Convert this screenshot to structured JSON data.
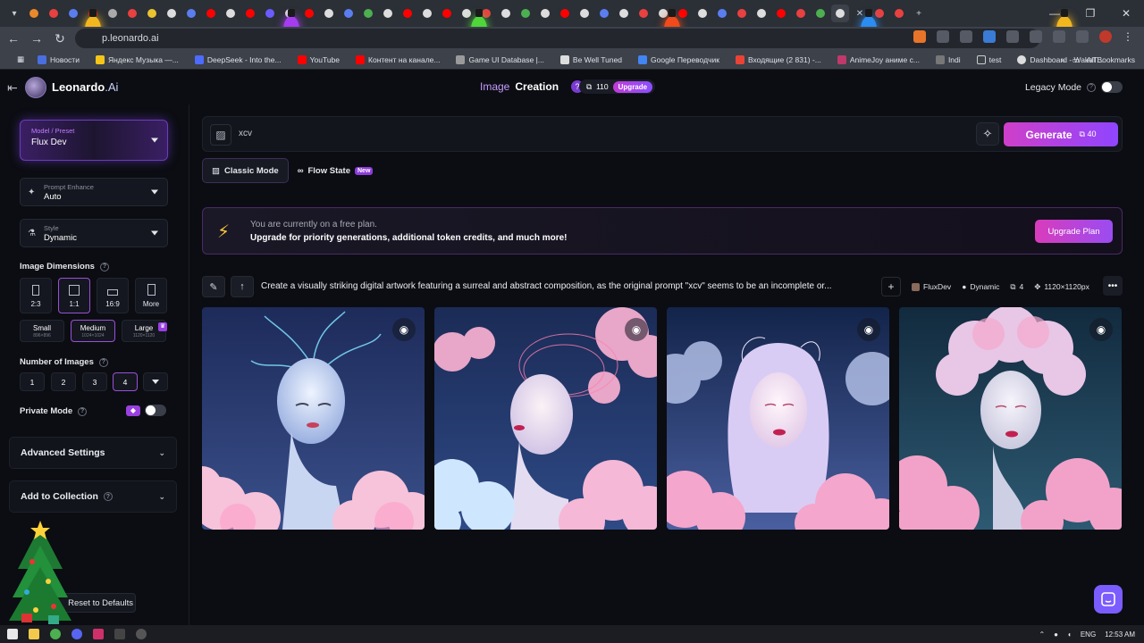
{
  "browser": {
    "url": "p.leonardo.ai",
    "bookmarks": [
      {
        "label": "Новости",
        "color": "#4a6ee0"
      },
      {
        "label": "Яндекс Музыка —...",
        "color": "#f5c518"
      },
      {
        "label": "DeepSeek - Into the...",
        "color": "#4d6bfe"
      },
      {
        "label": "YouTube",
        "color": "#ff0000"
      },
      {
        "label": "Контент на канале...",
        "color": "#ff0000"
      },
      {
        "label": "Game UI Database |...",
        "color": "#9a9a9a"
      },
      {
        "label": "Be Well Tuned",
        "color": "#dddddd"
      },
      {
        "label": "Google Переводчик",
        "color": "#4285f4"
      },
      {
        "label": "Входящие (2 831) -...",
        "color": "#ea4335"
      },
      {
        "label": "AnimeJoy аниме с...",
        "color": "#c0396b"
      },
      {
        "label": "Indi",
        "color": "#777777"
      },
      {
        "label": "test",
        "color": "#777777"
      },
      {
        "label": "Dashboard - WakaT...",
        "color": "#dddddd"
      }
    ],
    "all_bookmarks": "All Bookmarks"
  },
  "header": {
    "brand": "Leonardo",
    "brand_suffix": ".Ai",
    "title_image": "Image",
    "title_creation": "Creation",
    "help": "?",
    "tokens": "110",
    "upgrade": "Upgrade",
    "legacy_mode": "Legacy Mode"
  },
  "sidebar": {
    "model_label": "Model / Preset",
    "model_value": "Flux Dev",
    "enhance_label": "Prompt Enhance",
    "enhance_value": "Auto",
    "style_label": "Style",
    "style_value": "Dynamic",
    "dimensions_label": "Image Dimensions",
    "ratios": [
      "2:3",
      "1:1",
      "16:9",
      "More"
    ],
    "sizes": [
      {
        "label": "Small",
        "sub": "896×896"
      },
      {
        "label": "Medium",
        "sub": "1024×1024"
      },
      {
        "label": "Large",
        "sub": "1120×1120"
      }
    ],
    "num_images_label": "Number of Images",
    "num_images": [
      "1",
      "2",
      "3",
      "4"
    ],
    "private_mode": "Private Mode",
    "advanced": "Advanced Settings",
    "collection": "Add to Collection",
    "reset": "Reset to Defaults"
  },
  "main": {
    "prompt": "xcv",
    "generate": "Generate",
    "generate_cost": "40",
    "tabs": [
      {
        "label": "Classic Mode",
        "icon": "image-icon"
      },
      {
        "label": "Flow State",
        "icon": "infinity-icon",
        "badge": "New"
      }
    ],
    "banner_line1": "You are currently on a free plan.",
    "banner_line2": "Upgrade for priority generations, additional token credits, and much more!",
    "upgrade_plan": "Upgrade Plan",
    "generation": {
      "prompt": "Create a visually striking digital artwork featuring a surreal and abstract composition, as the original prompt \"xcv\" seems to be an incomplete or...",
      "model": "FluxDev",
      "style": "Dynamic",
      "count": "4",
      "dims": "1120×1120px"
    }
  },
  "taskbar": {
    "lang": "ENG",
    "time": "12:53 AM"
  }
}
